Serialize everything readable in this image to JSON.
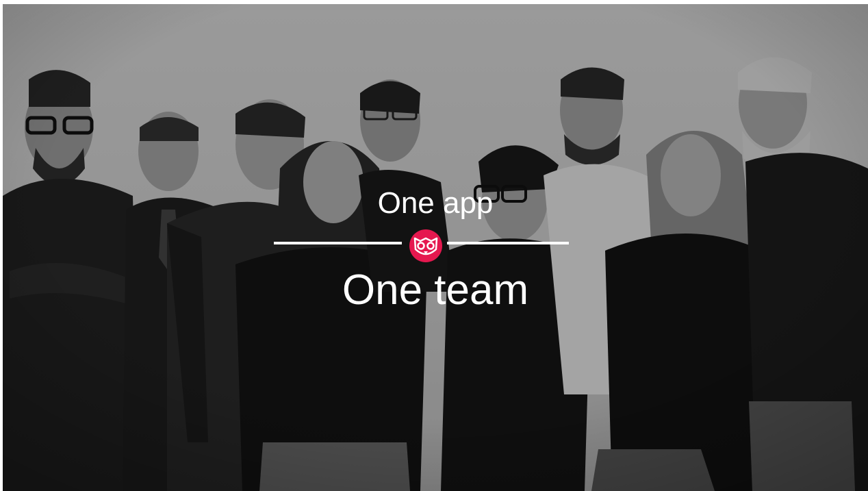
{
  "slide": {
    "line1": "One app",
    "line2": "One team",
    "accent_color": "#e5184f",
    "logo_icon": "owl-logo-icon",
    "photo": "black-and-white team group photo"
  }
}
